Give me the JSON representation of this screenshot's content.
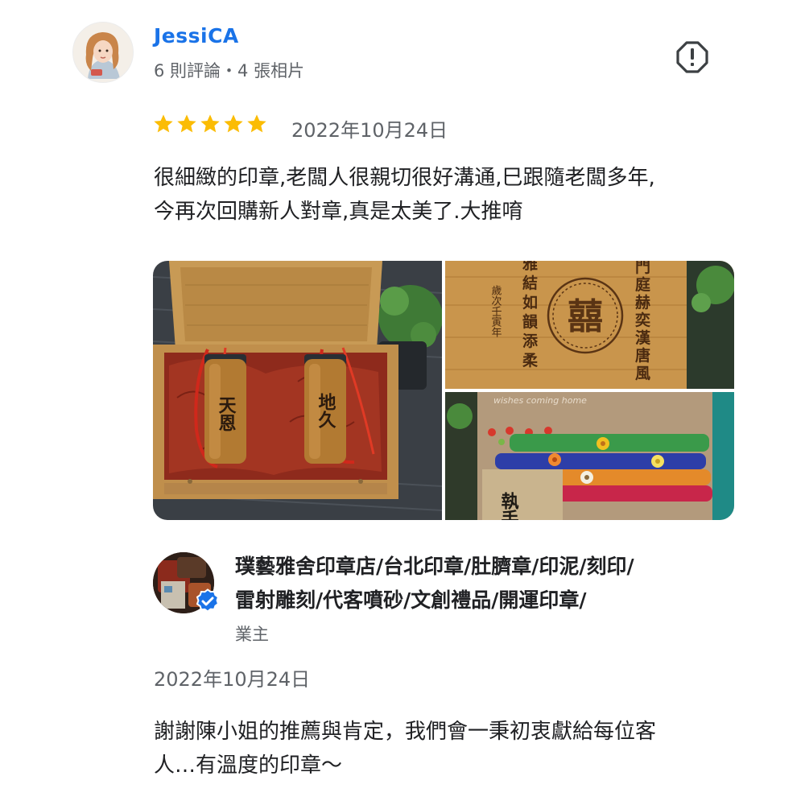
{
  "reviewer": {
    "name": "JessiCA",
    "meta": "6 則評論・4 張相片",
    "avatar_icon": "user-avatar-icon"
  },
  "review": {
    "rating": 5,
    "rating_max": 5,
    "star_color": "#fbbc04",
    "date": "2022年10月24日",
    "text_lines": [
      "很細緻的印章,老闆人很親切很好溝通,巳跟隨老闆多年,",
      "今再次回購新人對章,真是太美了.大推唷"
    ]
  },
  "photos": {
    "photo_1": {
      "seal_left": "天恩",
      "seal_right": "地久"
    },
    "photo_2": {
      "center_glyph": "囍",
      "left_verses": [
        "雅",
        "結",
        "如",
        "韻",
        "添",
        "柔"
      ],
      "small_text": "歲次壬寅年",
      "right_verses": [
        "門",
        "庭",
        "赫",
        "奕",
        "漢",
        "唐",
        "風"
      ]
    },
    "photo_3": {
      "card_text": "執手",
      "ribbon_text": "wishes coming home"
    }
  },
  "owner_response": {
    "name_lines": [
      "璞藝雅舍印章店/台北印章/肚臍章/印泥/刻印/",
      "雷射雕刻/代客噴砂/文創禮品/開運印章/"
    ],
    "role": "業主",
    "date": "2022年10月24日",
    "text_lines": [
      "謝謝陳小姐的推薦與肯定，我們會一秉初衷獻給每位客",
      "人…有溫度的印章～"
    ],
    "verified_icon": "verified-badge-icon",
    "verified_color": "#1a73e8"
  },
  "accent_link_color": "#1a73e8"
}
